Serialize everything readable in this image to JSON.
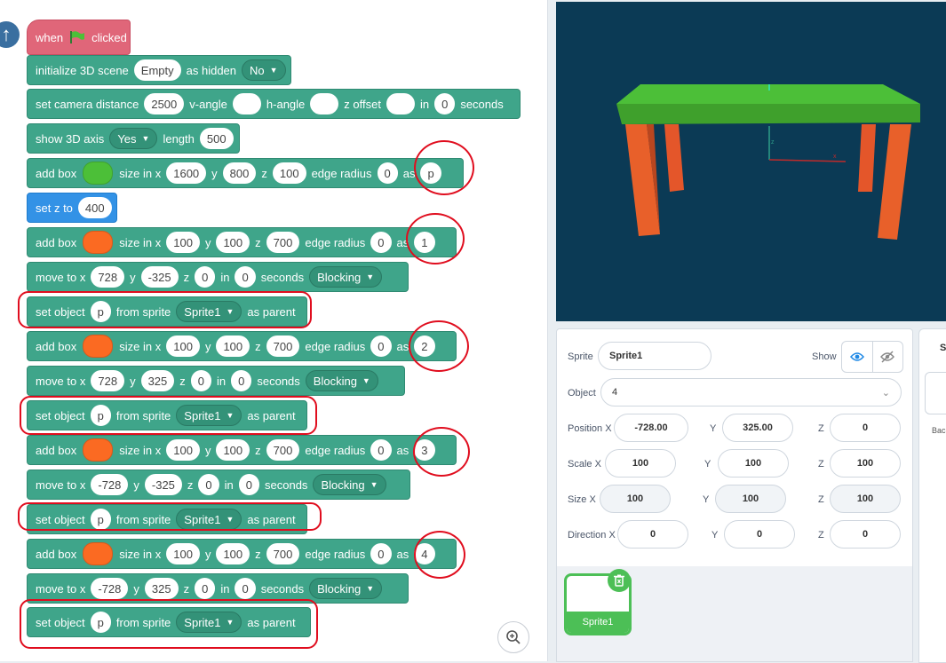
{
  "colors": {
    "green_fill": "#4cbf38",
    "orange_fill": "#fb6a22",
    "hat_block": "#e06679",
    "extension_block": "#3fa58a",
    "motion_block": "#3392e6",
    "annotation_red": "#e00d1e",
    "stage_bg": "#0b3a55"
  },
  "hat": {
    "when": "when",
    "flag_icon": "green-flag-icon",
    "clicked": "clicked"
  },
  "blocks": {
    "init": {
      "t1": "initialize 3D scene",
      "scene": "Empty",
      "t2": "as hidden",
      "hidden": "No"
    },
    "camera": {
      "t1": "set camera distance",
      "distance": "2500",
      "t2": "v-angle",
      "v_angle": "",
      "t3": "h-angle",
      "h_angle": "",
      "t4": "z offset",
      "z_offset": "",
      "t5": "in",
      "secs": "0",
      "t6": "seconds"
    },
    "axis": {
      "t1": "show 3D axis",
      "show": "Yes",
      "t2": "length",
      "length": "500"
    },
    "box_p": {
      "t1": "add box",
      "t2": "size in x",
      "x": "1600",
      "t3": "y",
      "y": "800",
      "t4": "z",
      "z": "100",
      "t5": "edge radius",
      "r": "0",
      "t6": "as",
      "name": "p"
    },
    "setz": {
      "t1": "set z to",
      "z": "400"
    },
    "box1": {
      "t1": "add box",
      "t2": "size in x",
      "x": "100",
      "t3": "y",
      "y": "100",
      "t4": "z",
      "z": "700",
      "t5": "edge radius",
      "r": "0",
      "t6": "as",
      "name": "1"
    },
    "move1": {
      "t1": "move to x",
      "x": "728",
      "t2": "y",
      "y": "-325",
      "t3": "z",
      "z": "0",
      "t4": "in",
      "secs": "0",
      "t5": "seconds",
      "mode": "Blocking"
    },
    "parent1": {
      "t1": "set object",
      "obj": "p",
      "t2": "from sprite",
      "sprite": "Sprite1",
      "t3": "as parent"
    },
    "box2": {
      "t1": "add box",
      "t2": "size in x",
      "x": "100",
      "t3": "y",
      "y": "100",
      "t4": "z",
      "z": "700",
      "t5": "edge radius",
      "r": "0",
      "t6": "as",
      "name": "2"
    },
    "move2": {
      "t1": "move to x",
      "x": "728",
      "t2": "y",
      "y": "325",
      "t3": "z",
      "z": "0",
      "t4": "in",
      "secs": "0",
      "t5": "seconds",
      "mode": "Blocking"
    },
    "parent2": {
      "t1": "set object",
      "obj": "p",
      "t2": "from sprite",
      "sprite": "Sprite1",
      "t3": "as parent"
    },
    "box3": {
      "t1": "add box",
      "t2": "size in x",
      "x": "100",
      "t3": "y",
      "y": "100",
      "t4": "z",
      "z": "700",
      "t5": "edge radius",
      "r": "0",
      "t6": "as",
      "name": "3"
    },
    "move3": {
      "t1": "move to x",
      "x": "-728",
      "t2": "y",
      "y": "-325",
      "t3": "z",
      "z": "0",
      "t4": "in",
      "secs": "0",
      "t5": "seconds",
      "mode": "Blocking"
    },
    "parent3": {
      "t1": "set object",
      "obj": "p",
      "t2": "from sprite",
      "sprite": "Sprite1",
      "t3": "as parent"
    },
    "box4": {
      "t1": "add box",
      "t2": "size in x",
      "x": "100",
      "t3": "y",
      "y": "100",
      "t4": "z",
      "z": "700",
      "t5": "edge radius",
      "r": "0",
      "t6": "as",
      "name": "4"
    },
    "move4": {
      "t1": "move to x",
      "x": "-728",
      "t2": "y",
      "y": "325",
      "t3": "z",
      "z": "0",
      "t4": "in",
      "secs": "0",
      "t5": "seconds",
      "mode": "Blocking"
    },
    "parent4": {
      "t1": "set object",
      "obj": "p",
      "t2": "from sprite",
      "sprite": "Sprite1",
      "t3": "as parent"
    }
  },
  "props": {
    "sprite_label": "Sprite",
    "sprite_value": "Sprite1",
    "show_label": "Show",
    "object_label": "Object",
    "object_value": "4",
    "position_x_label": "Position X",
    "position_x": "-728.00",
    "position_y_label": "Y",
    "position_y": "325.00",
    "position_z_label": "Z",
    "position_z": "0",
    "scale_x_label": "Scale X",
    "scale_x": "100",
    "scale_y_label": "Y",
    "scale_y": "100",
    "scale_z_label": "Z",
    "scale_z": "100",
    "size_x_label": "Size X",
    "size_x": "100",
    "size_y_label": "Y",
    "size_y": "100",
    "size_z_label": "Z",
    "size_z": "100",
    "direction_x_label": "Direction X",
    "direction_x": "0",
    "direction_y_label": "Y",
    "direction_y": "0",
    "direction_z_label": "Z",
    "direction_z": "0"
  },
  "sprite_list": {
    "sprite_name": "Sprite1"
  },
  "right_panel": {
    "tab_partial": "St",
    "label_partial": "Bac"
  }
}
